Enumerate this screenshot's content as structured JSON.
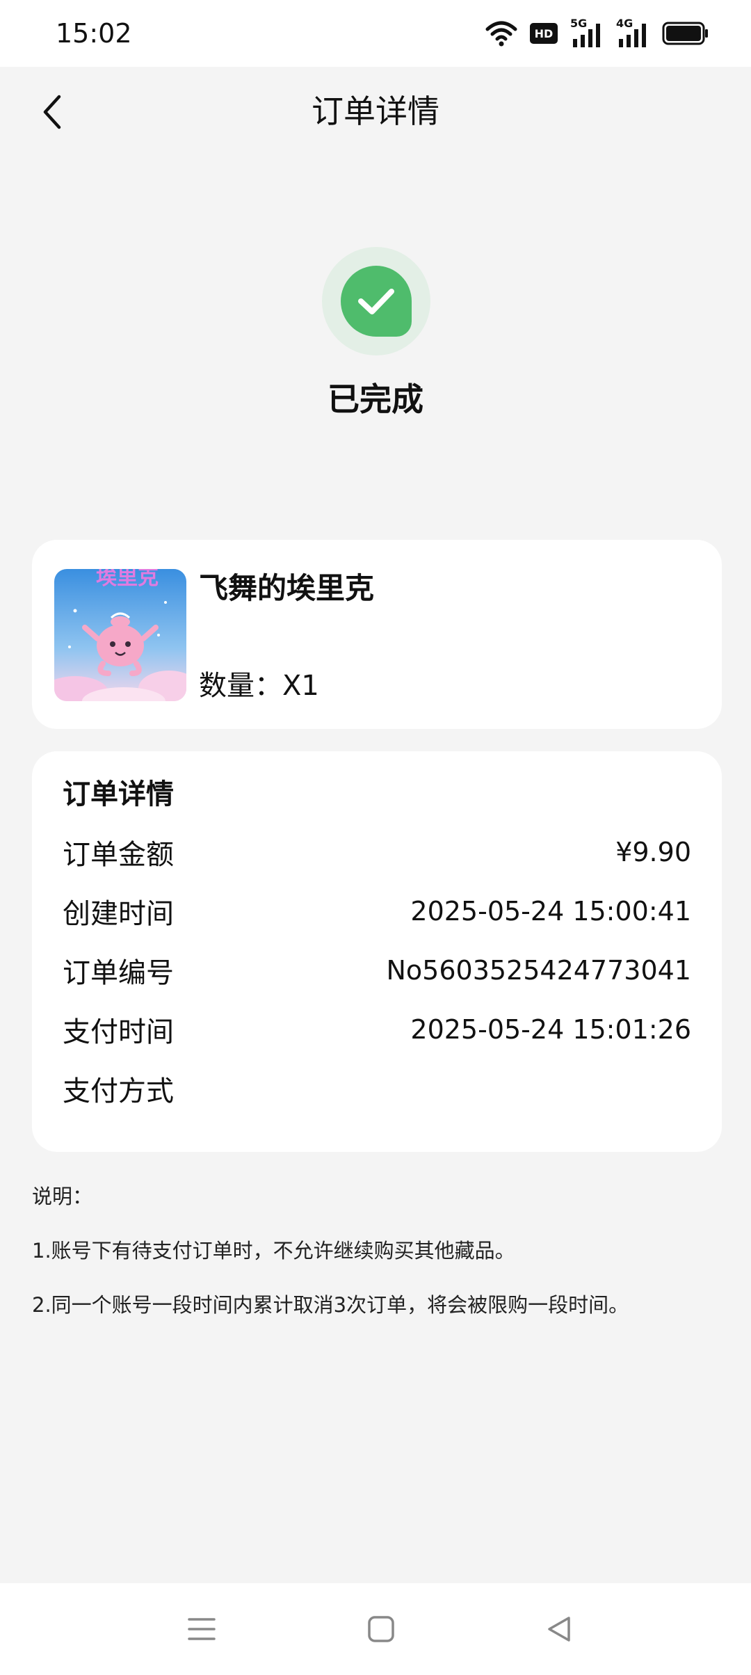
{
  "status_bar": {
    "time": "15:02",
    "icons": [
      "wifi-icon",
      "hd-icon",
      "signal-5g-icon",
      "signal-4g-icon",
      "battery-icon"
    ],
    "hd_label": "HD",
    "tech_1": "5G",
    "tech_2": "4G"
  },
  "header": {
    "title": "订单详情",
    "back_icon": "chevron-left-icon"
  },
  "order_status": {
    "text": "已完成",
    "icon": "check-icon",
    "color": "#4fbc6c"
  },
  "product": {
    "name": "飞舞的埃里克",
    "quantity_label": "数量：X1",
    "image_text": "埃里克"
  },
  "details": {
    "title": "订单详情",
    "rows": [
      {
        "label": "订单金额",
        "value": "¥9.90"
      },
      {
        "label": "创建时间",
        "value": "2025-05-24 15:00:41"
      },
      {
        "label": "订单编号",
        "value": "No5603525424773041"
      },
      {
        "label": "支付时间",
        "value": "2025-05-24 15:01:26"
      },
      {
        "label": "支付方式",
        "value": ""
      }
    ]
  },
  "notes": {
    "title": "说明：",
    "items": [
      "1.账号下有待支付订单时，不允许继续购买其他藏品。",
      "2.同一个账号一段时间内累计取消3次订单，将会被限购一段时间。"
    ]
  },
  "nav": {
    "icons": [
      "menu-icon",
      "home-square-icon",
      "back-triangle-icon"
    ]
  }
}
